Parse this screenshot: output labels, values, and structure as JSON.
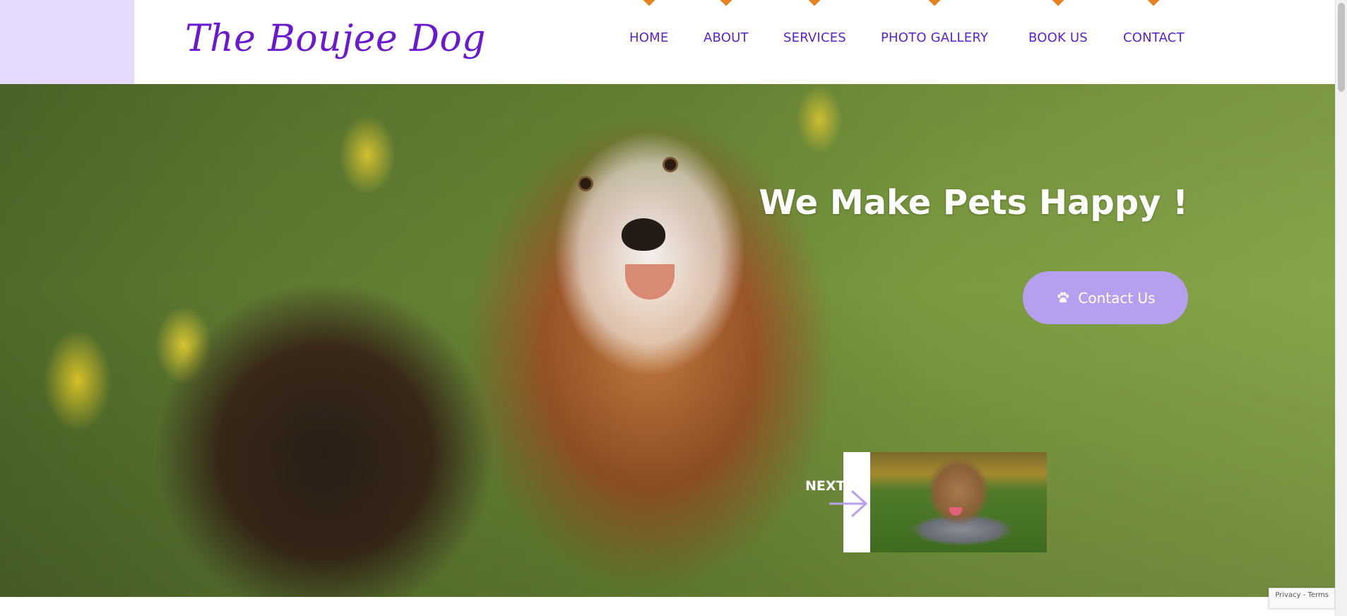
{
  "brand": {
    "logo_text": "The Boujee Dog"
  },
  "nav": {
    "items": [
      {
        "label": "HOME"
      },
      {
        "label": "ABOUT"
      },
      {
        "label": "SERVICES"
      },
      {
        "label": "PHOTO GALLERY"
      },
      {
        "label": "BOOK US"
      },
      {
        "label": "CONTACT"
      }
    ]
  },
  "hero": {
    "title": "We Make Pets Happy !",
    "cta_label": "Contact Us",
    "next_label": "NEXT"
  },
  "footer": {
    "recaptcha_text": "Privacy - Terms"
  },
  "colors": {
    "brand_purple": "#6a18d1",
    "nav_text": "#5a1fd8",
    "nav_marker": "#e5821e",
    "cta_bg": "#b79ff0",
    "header_accent": "#e5daff"
  },
  "icons": {
    "cta_icon": "paw-icon",
    "next_icon": "arrow-right-icon"
  }
}
